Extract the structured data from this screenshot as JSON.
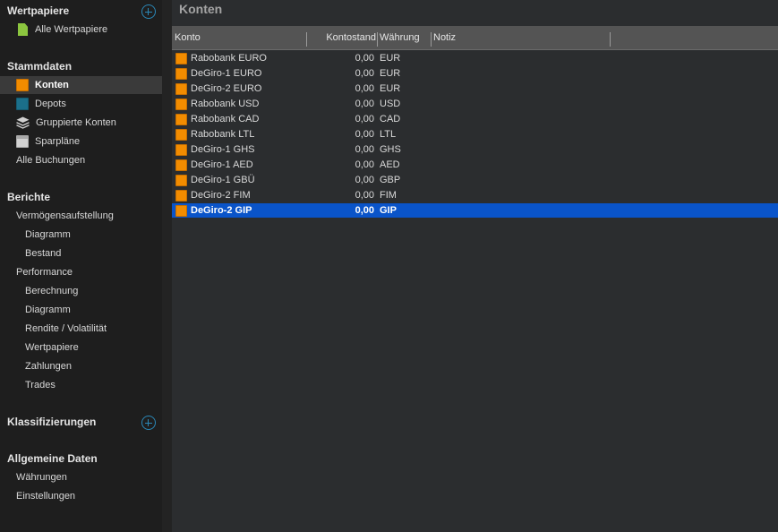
{
  "sidebar": {
    "sections": {
      "wertpapiere": "Wertpapiere",
      "stammdaten": "Stammdaten",
      "berichte": "Berichte",
      "klassifizierungen": "Klassifizierungen",
      "allgemeine": "Allgemeine Daten"
    },
    "items": {
      "alle_wertpapiere": "Alle Wertpapiere",
      "konten": "Konten",
      "depots": "Depots",
      "gruppierte_konten": "Gruppierte Konten",
      "sparplaene": "Sparpläne",
      "alle_buchungen": "Alle Buchungen",
      "vermoegen": "Vermögensaufstellung",
      "vermoegen_diagramm": "Diagramm",
      "bestand": "Bestand",
      "performance": "Performance",
      "berechnung": "Berechnung",
      "perf_diagramm": "Diagramm",
      "rendite": "Rendite / Volatilität",
      "perf_wertpapiere": "Wertpapiere",
      "zahlungen": "Zahlungen",
      "trades": "Trades",
      "waehrungen": "Währungen",
      "einstellungen": "Einstellungen"
    }
  },
  "main": {
    "title": "Konten",
    "columns": {
      "konto": "Konto",
      "kontostand": "Kontostand",
      "waehrung": "Währung",
      "notiz": "Notiz"
    },
    "rows": [
      {
        "name": "Rabobank EURO",
        "balance": "0,00",
        "currency": "EUR"
      },
      {
        "name": "DeGiro-1 EURO",
        "balance": "0,00",
        "currency": "EUR"
      },
      {
        "name": "DeGiro-2 EURO",
        "balance": "0,00",
        "currency": "EUR"
      },
      {
        "name": "Rabobank USD",
        "balance": "0,00",
        "currency": "USD"
      },
      {
        "name": "Rabobank CAD",
        "balance": "0,00",
        "currency": "CAD"
      },
      {
        "name": "Rabobank LTL",
        "balance": "0,00",
        "currency": "LTL"
      },
      {
        "name": "DeGiro-1 GHS",
        "balance": "0,00",
        "currency": "GHS"
      },
      {
        "name": "DeGiro-1 AED",
        "balance": "0,00",
        "currency": "AED"
      },
      {
        "name": "DeGiro-1 GBÜ",
        "balance": "0,00",
        "currency": "GBP"
      },
      {
        "name": "DeGiro-2 FIM",
        "balance": "0,00",
        "currency": "FIM"
      },
      {
        "name": "DeGiro-2 GIP",
        "balance": "0,00",
        "currency": "GIP"
      }
    ]
  },
  "colors": {
    "selection": "#0a54c9",
    "account_icon": "#f28c00",
    "add_icon": "#2b88b7"
  }
}
